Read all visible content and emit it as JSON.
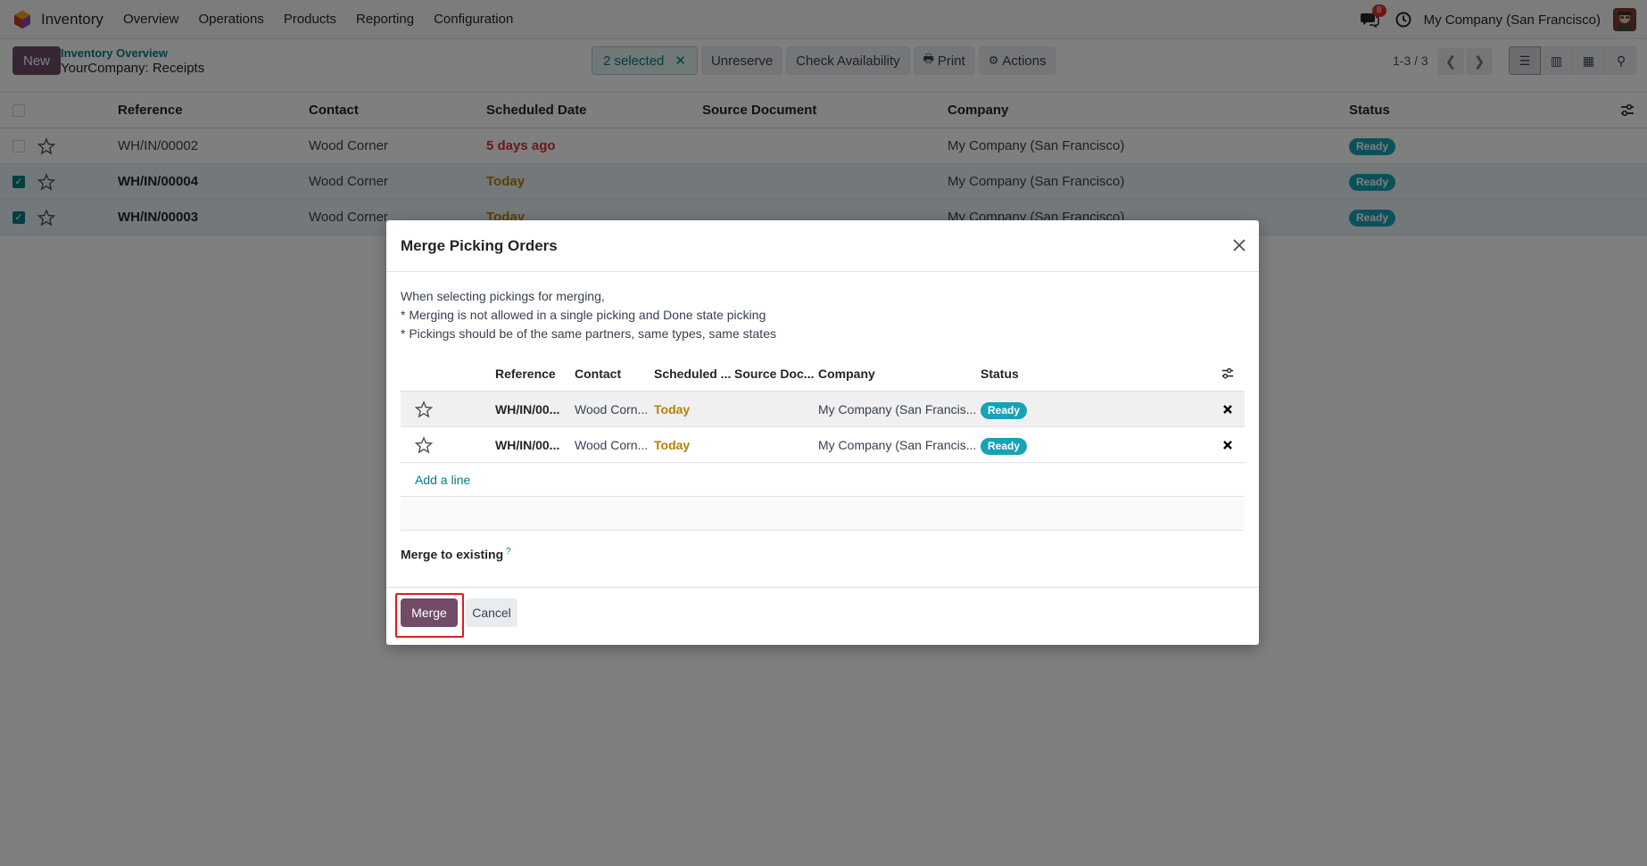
{
  "navbar": {
    "app_name": "Inventory",
    "menu": [
      "Overview",
      "Operations",
      "Products",
      "Reporting",
      "Configuration"
    ],
    "message_count": "8",
    "company": "My Company (San Francisco)"
  },
  "control_panel": {
    "new_label": "New",
    "breadcrumb_parent": "Inventory Overview",
    "breadcrumb_current": "YourCompany: Receipts",
    "selected_label": "2 selected",
    "unreserve_label": "Unreserve",
    "check_availability_label": "Check Availability",
    "print_label": "Print",
    "actions_label": "Actions",
    "pager": "1-3 / 3"
  },
  "list": {
    "columns": {
      "reference": "Reference",
      "contact": "Contact",
      "scheduled_date": "Scheduled Date",
      "source_document": "Source Document",
      "company": "Company",
      "status": "Status"
    },
    "rows": [
      {
        "reference": "WH/IN/00002",
        "contact": "Wood Corner",
        "scheduled_date": "5 days ago",
        "company": "My Company (San Francisco)",
        "status": "Ready",
        "selected": false
      },
      {
        "reference": "WH/IN/00004",
        "contact": "Wood Corner",
        "scheduled_date": "Today",
        "company": "My Company (San Francisco)",
        "status": "Ready",
        "selected": true
      },
      {
        "reference": "WH/IN/00003",
        "contact": "Wood Corner",
        "scheduled_date": "Today",
        "company": "My Company (San Francisco)",
        "status": "Ready",
        "selected": true
      }
    ]
  },
  "modal": {
    "title": "Merge Picking Orders",
    "instructions": [
      "When selecting pickings for merging,",
      "* Merging is not allowed in a single picking and Done state picking",
      "* Pickings should be of the same partners, same types, same states"
    ],
    "columns": {
      "reference": "Reference",
      "contact": "Contact",
      "scheduled": "Scheduled ...",
      "source_doc": "Source Doc...",
      "company": "Company",
      "status": "Status"
    },
    "rows": [
      {
        "reference": "WH/IN/00...",
        "contact": "Wood Corn...",
        "scheduled": "Today",
        "company": "My Company (San Francis...",
        "status": "Ready"
      },
      {
        "reference": "WH/IN/00...",
        "contact": "Wood Corn...",
        "scheduled": "Today",
        "company": "My Company (San Francis...",
        "status": "Ready"
      }
    ],
    "add_line": "Add a line",
    "merge_to_existing": "Merge to existing",
    "help_mark": "?",
    "merge_label": "Merge",
    "cancel_label": "Cancel"
  },
  "colors": {
    "brand": "#714b67",
    "accent": "#017e84",
    "late": "#d9302f",
    "today": "#b58105",
    "ready_badge": "#17a2b8"
  }
}
